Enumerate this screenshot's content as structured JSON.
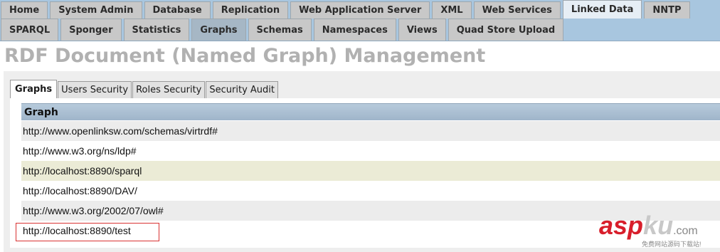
{
  "nav_primary": [
    "Home",
    "System Admin",
    "Database",
    "Replication",
    "Web Application Server",
    "XML",
    "Web Services",
    "Linked Data",
    "NNTP"
  ],
  "nav_secondary": [
    "SPARQL",
    "Sponger",
    "Statistics",
    "Graphs",
    "Schemas",
    "Namespaces",
    "Views",
    "Quad Store Upload"
  ],
  "page": {
    "title": "RDF Document (Named Graph) Management"
  },
  "subtabs": [
    "Graphs",
    "Users Security",
    "Roles Security",
    "Security Audit"
  ],
  "table": {
    "header": "Graph",
    "rows": [
      "http://www.openlinksw.com/schemas/virtrdf#",
      "http://www.w3.org/ns/ldp#",
      "http://localhost:8890/sparql",
      "http://localhost:8890/DAV/",
      "http://www.w3.org/2002/07/owl#",
      "http://localhost:8890/test"
    ]
  },
  "watermark": {
    "brand": "asp",
    "brand2": "ku",
    "suffix": ".com",
    "sub": "免费网站源码下载站!"
  },
  "colors": {
    "nav_bg": "#a8c6df",
    "highlight_row": "#ebebd6",
    "annotation_box": "#d93232",
    "watermark": "#d81e2b"
  }
}
